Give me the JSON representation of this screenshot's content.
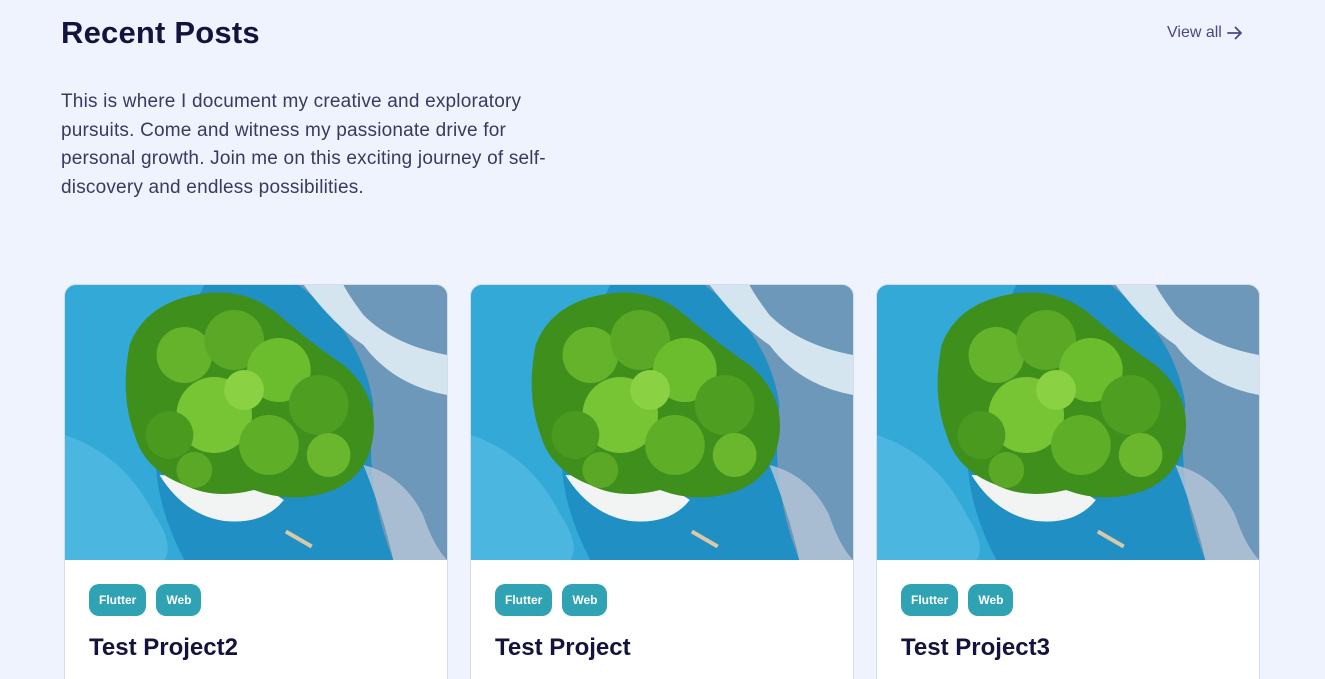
{
  "header": {
    "title": "Recent Posts",
    "view_all_label": "View all",
    "view_all_icon": "arrow-right-icon"
  },
  "intro": {
    "text": "This is where I document my creative and exploratory pursuits. Come and witness my passionate drive for personal growth. Join me on this exciting journey of self-discovery and endless possibilities."
  },
  "posts": [
    {
      "title": "Test Project2",
      "tags": [
        "Flutter",
        "Web"
      ]
    },
    {
      "title": "Test Project",
      "tags": [
        "Flutter",
        "Web"
      ]
    },
    {
      "title": "Test Project3",
      "tags": [
        "Flutter",
        "Web"
      ]
    }
  ],
  "colors": {
    "background": "#eef3fd",
    "heading": "#14133d",
    "tag": "#2fa3b3",
    "link": "#4b4784"
  }
}
